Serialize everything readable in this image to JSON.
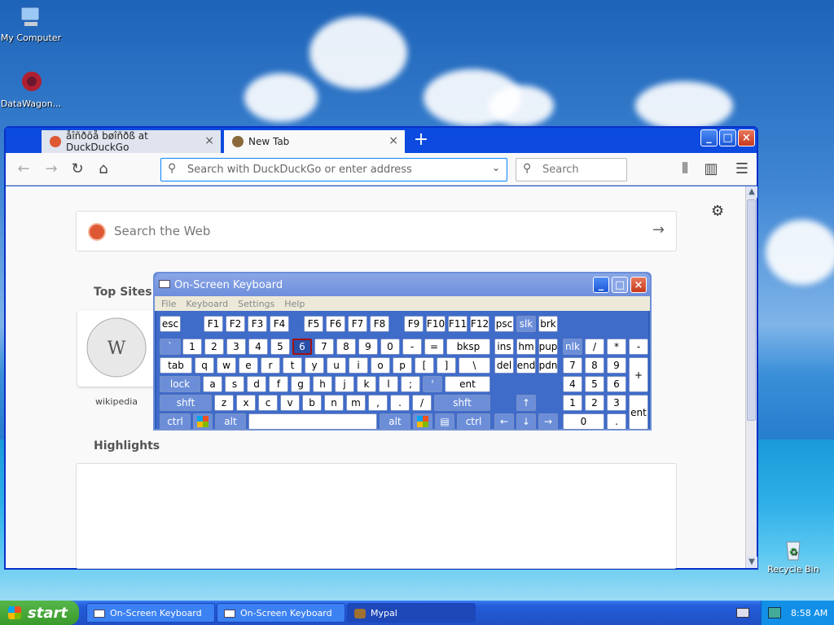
{
  "desktop": {
    "icons": [
      {
        "label": "My Computer"
      },
      {
        "label": "DataWagon..."
      },
      {
        "label": "Recycle Bin"
      }
    ]
  },
  "browser": {
    "tabs": [
      {
        "label": "åîñðõå bøîñðß at DuckDuckGo",
        "active": false
      },
      {
        "label": "New Tab",
        "active": true
      }
    ],
    "url_placeholder": "Search with DuckDuckGo or enter address",
    "search_placeholder": "Search",
    "ddg_placeholder": "Search the Web",
    "top_sites_title": "Top Sites",
    "top_sites": [
      {
        "label": "wikipedia"
      }
    ],
    "highlights_title": "Highlights"
  },
  "osk": {
    "title": "On-Screen Keyboard",
    "menu": [
      "File",
      "Keyboard",
      "Settings",
      "Help"
    ],
    "pressed_key": "6"
  },
  "taskbar": {
    "start_label": "start",
    "buttons": [
      {
        "label": "On-Screen Keyboard"
      },
      {
        "label": "On-Screen Keyboard"
      },
      {
        "label": "Mypal"
      }
    ],
    "clock": "8:58 AM"
  }
}
